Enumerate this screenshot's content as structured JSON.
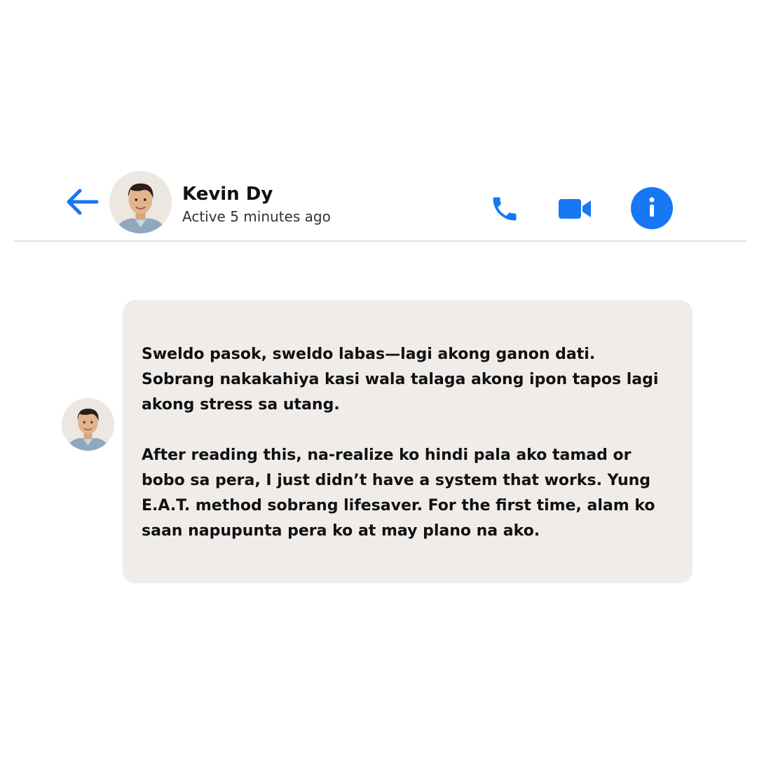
{
  "header": {
    "back_icon": "arrow-left-icon",
    "contact_name": "Kevin Dy",
    "status": "Active 5 minutes ago",
    "actions": [
      {
        "icon": "phone-icon"
      },
      {
        "icon": "video-camera-icon"
      },
      {
        "icon": "info-icon"
      }
    ]
  },
  "message": {
    "paragraphs": [
      "Sweldo pasok, sweldo labas—lagi akong ganon dati.\nSobrang nakakahiya kasi wala talaga akong ipon tapos lagi\nakong stress sa utang.",
      "After reading this, na-realize ko hindi pala ako tamad or\nbobo sa pera, I just didn’t have a system that works. Yung\nE.A.T. method sobrang lifesaver. For the first time, alam ko\nsaan napupunta pera ko at may plano na ako."
    ]
  },
  "colors": {
    "accent": "#1877f2",
    "bubble_background": "#efecea",
    "divider": "#dedede",
    "text": "#111111"
  }
}
